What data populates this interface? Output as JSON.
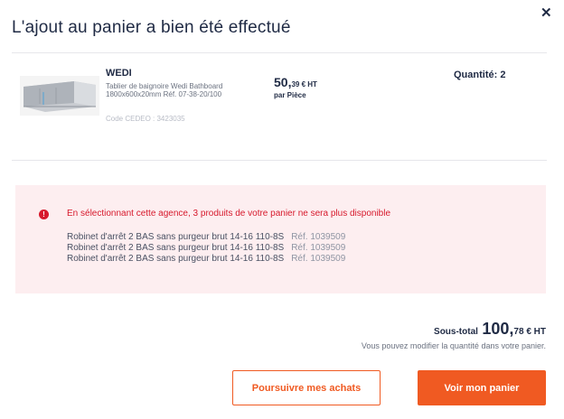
{
  "modal": {
    "title": "L'ajout au panier a bien été effectué",
    "close_icon": "close-icon",
    "close_glyph": "✕"
  },
  "product": {
    "brand": "WEDI",
    "description_line1": "Tablier de baignoire Wedi Bathboard",
    "description_line2": "1800x600x20mm Réf. 07-38-20/100",
    "code": "Code CEDEO : 3423035",
    "price_main": "50,",
    "price_cents": "39 € HT",
    "price_unit": "par Pièce",
    "quantity_label": "Quantité: 2",
    "image_icon": "bathtub-panel-image"
  },
  "alert": {
    "icon": "error-icon",
    "icon_glyph": "!",
    "message": "En sélectionnant cette agence, 3 produits de votre panier ne sera plus disponible",
    "color": "#d7192c",
    "items": [
      {
        "name": "Robinet d'arrêt 2 BAS sans purgeur brut 14-16 110-8S",
        "ref": "Réf. 1039509"
      },
      {
        "name": "Robinet d'arrêt 2 BAS sans purgeur brut 14-16 110-8S",
        "ref": "Réf. 1039509"
      },
      {
        "name": "Robinet d'arrêt 2 BAS sans purgeur brut 14-16 110-8S",
        "ref": "Réf. 1039509"
      }
    ]
  },
  "summary": {
    "subtotal_label": "Sous-total",
    "subtotal_amount": "100,",
    "subtotal_cents": "78 € HT",
    "note": "Vous pouvez modifier la quantité dans votre panier."
  },
  "actions": {
    "continue_label": "Poursuivre mes achats",
    "cart_label": "Voir mon panier"
  },
  "colors": {
    "accent": "#f05a22",
    "text": "#1f2a44",
    "alert_bg": "#fdeef0"
  }
}
